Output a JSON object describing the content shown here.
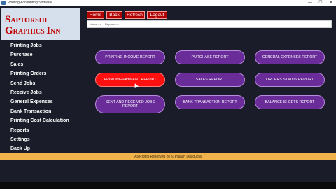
{
  "window": {
    "title": "Printing Accounting Software",
    "controls": [
      "—",
      "☐",
      "✕"
    ]
  },
  "logo": {
    "line1_initial": "S",
    "line1_rest": "APTORSHI",
    "line2_initial1": "G",
    "line2_rest1": "RAPHICS",
    "line2_initial2": "I",
    "line2_rest2": "NN"
  },
  "sidebar": {
    "items": [
      {
        "label": "Printing Jobs"
      },
      {
        "label": "Purchase"
      },
      {
        "label": "Sales"
      },
      {
        "label": "Printing Orders"
      },
      {
        "label": "Send Jobs"
      },
      {
        "label": "Receive Jobs"
      },
      {
        "label": "General Expenses"
      },
      {
        "label": "Bank Transaction"
      },
      {
        "label": "Printing Cost Calculation"
      },
      {
        "label": "Reports"
      },
      {
        "label": "Settings"
      },
      {
        "label": "Back Up"
      }
    ]
  },
  "toolbar": {
    "home": "Home",
    "back": "Back",
    "refresh": "Refresh",
    "logout": "Logout"
  },
  "breadcrumb": {
    "home": "Home >>",
    "current": "Reports >>"
  },
  "reports": {
    "printing_income": "PRINTING INCOME REPORT",
    "purchase": "PURCHASE REPORT",
    "general_expenses": "GENERAL EXPENSES REPORT",
    "printing_payment": "PRINTING PAYMENT REPORT",
    "sales": "SALES REPORT",
    "orders_status": "ORDERS STATUS REPORT",
    "sent_received_jobs": "SENT AND RECEIVED JOBS REPORT",
    "bank_transaction": "BANK TRANSACTION REPORT",
    "balance_sheets": "BALANCE SHEETS REPORT"
  },
  "footer": {
    "text": "All Rights Reserved By © Palash Dasgupta"
  },
  "colors": {
    "background": "#1a1d29",
    "button_purple": "#6a2c99",
    "button_active": "#ff1010",
    "toolbar_red": "#b00000",
    "footer": "#f0b24a",
    "logo_text": "#c00000"
  }
}
